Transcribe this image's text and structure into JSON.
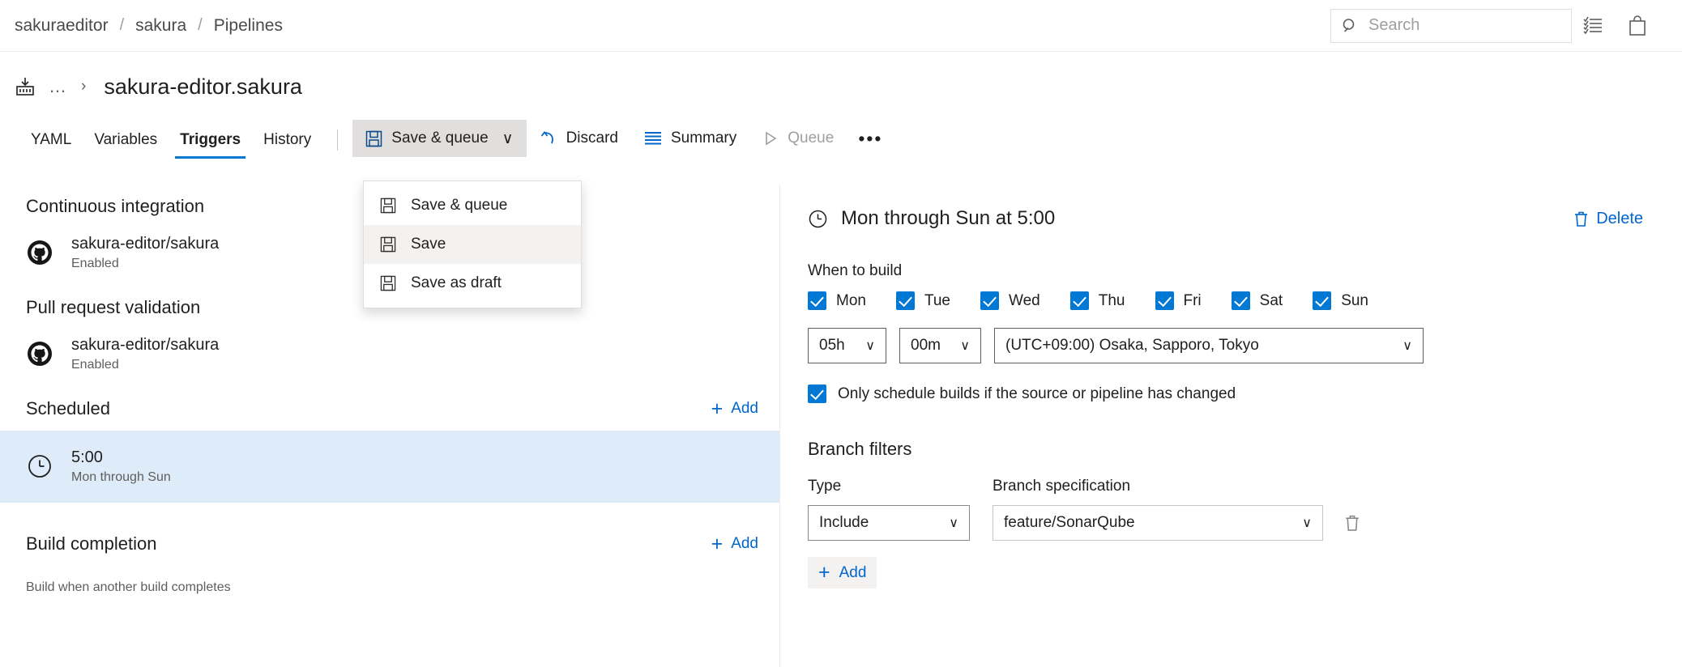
{
  "breadcrumb": {
    "org": "sakuraeditor",
    "project": "sakura",
    "section": "Pipelines",
    "separator": "/"
  },
  "search": {
    "placeholder": "Search",
    "icon": "search-icon"
  },
  "top_icons": [
    {
      "name": "task-list-icon",
      "label": ""
    },
    {
      "name": "shopping-bag-icon",
      "label": ""
    }
  ],
  "pipeline": {
    "icon": "pipeline-icon",
    "overflow": "…",
    "chevron": "›",
    "title": "sakura-editor.sakura"
  },
  "tabs": [
    {
      "label": "YAML",
      "active": false
    },
    {
      "label": "Variables",
      "active": false
    },
    {
      "label": "Triggers",
      "active": true
    },
    {
      "label": "History",
      "active": false
    }
  ],
  "toolbar": {
    "save_queue_label": "Save & queue",
    "save_queue_chevron": "∨",
    "discard_label": "Discard",
    "summary_label": "Summary",
    "queue_label": "Queue",
    "ellipsis_label": "•••"
  },
  "save_menu": {
    "items": [
      {
        "label": "Save & queue",
        "hover": false
      },
      {
        "label": "Save",
        "hover": true
      },
      {
        "label": "Save as draft",
        "hover": false
      }
    ]
  },
  "left_pane": {
    "sections": [
      {
        "title": "Continuous integration",
        "add": null,
        "items": [
          {
            "icon": "github-icon",
            "name": "sakura-editor/sakura",
            "status": "Enabled",
            "selected": false
          }
        ]
      },
      {
        "title": "Pull request validation",
        "add": null,
        "items": [
          {
            "icon": "github-icon",
            "name": "sakura-editor/sakura",
            "status": "Enabled",
            "selected": false
          }
        ]
      },
      {
        "title": "Scheduled",
        "add": "Add",
        "items": [
          {
            "icon": "clock-icon",
            "name": "5:00",
            "status": "Mon through Sun",
            "selected": true
          }
        ]
      },
      {
        "title": "Build completion",
        "add": "Add",
        "items": [],
        "hint": "Build when another build completes"
      }
    ],
    "add_plus": "+"
  },
  "detail": {
    "title": "Mon through Sun at 5:00",
    "title_icon": "clock-icon",
    "delete_label": "Delete",
    "delete_icon": "trash-icon",
    "when_to_build_label": "When to build",
    "days": [
      {
        "label": "Mon",
        "checked": true
      },
      {
        "label": "Tue",
        "checked": true
      },
      {
        "label": "Wed",
        "checked": true
      },
      {
        "label": "Thu",
        "checked": true
      },
      {
        "label": "Fri",
        "checked": true
      },
      {
        "label": "Sat",
        "checked": true
      },
      {
        "label": "Sun",
        "checked": true
      }
    ],
    "hour_value": "05h",
    "minute_value": "00m",
    "timezone_value": "(UTC+09:00) Osaka, Sapporo, Tokyo",
    "only_changed_label": "Only schedule builds if the source or pipeline has changed",
    "only_changed_checked": true,
    "branch_filters": {
      "title": "Branch filters",
      "type_header": "Type",
      "branch_header": "Branch specification",
      "rows": [
        {
          "type": "Include",
          "branch": "feature/SonarQube",
          "delete_icon": "trash-icon"
        }
      ],
      "add_label": "Add",
      "add_plus": "+"
    },
    "chevron": "∨"
  },
  "colors": {
    "accent": "#0078d4",
    "link": "#0066cc",
    "selected_row_bg": "#deecf9",
    "toolbar_active_bg": "#e1dfdd",
    "menu_hover_bg": "#f3f2f1"
  }
}
